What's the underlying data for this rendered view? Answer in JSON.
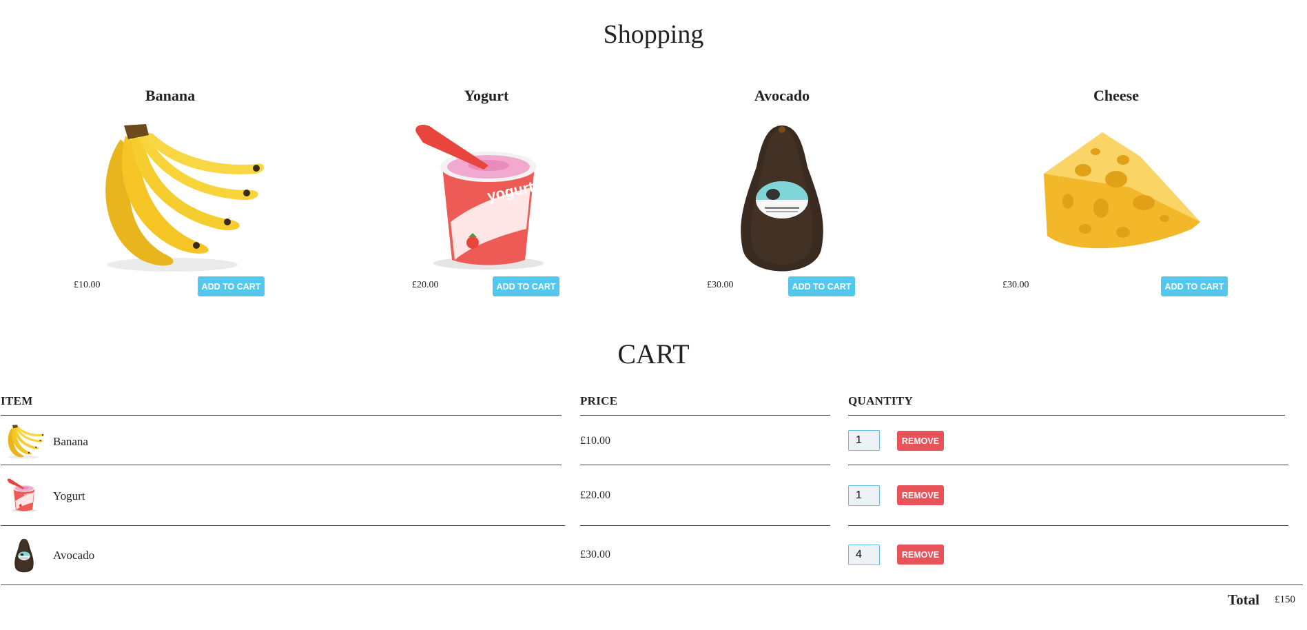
{
  "shop": {
    "title": "Shopping",
    "products": [
      {
        "name": "Banana",
        "price": "£10.00",
        "button": "ADD TO CART",
        "icon": "banana-image"
      },
      {
        "name": "Yogurt",
        "price": "£20.00",
        "button": "ADD TO CART",
        "icon": "yogurt-image"
      },
      {
        "name": "Avocado",
        "price": "£30.00",
        "button": "ADD TO CART",
        "icon": "avocado-image"
      },
      {
        "name": "Cheese",
        "price": "£30.00",
        "button": "ADD TO CART",
        "icon": "cheese-image"
      }
    ]
  },
  "cart": {
    "title": "CART",
    "columns": {
      "item": "ITEM",
      "price": "PRICE",
      "quantity": "QUANTITY"
    },
    "rows": [
      {
        "name": "Banana",
        "price": "£10.00",
        "quantity": "1",
        "remove": "REMOVE",
        "icon": "banana-image"
      },
      {
        "name": "Yogurt",
        "price": "£20.00",
        "quantity": "1",
        "remove": "REMOVE",
        "icon": "yogurt-image"
      },
      {
        "name": "Avocado",
        "price": "£30.00",
        "quantity": "4",
        "remove": "REMOVE",
        "icon": "avocado-image"
      }
    ],
    "total_label": "Total",
    "total_value": "£150"
  },
  "colors": {
    "add_button": "#55c6ec",
    "remove_button": "#e8535a"
  }
}
